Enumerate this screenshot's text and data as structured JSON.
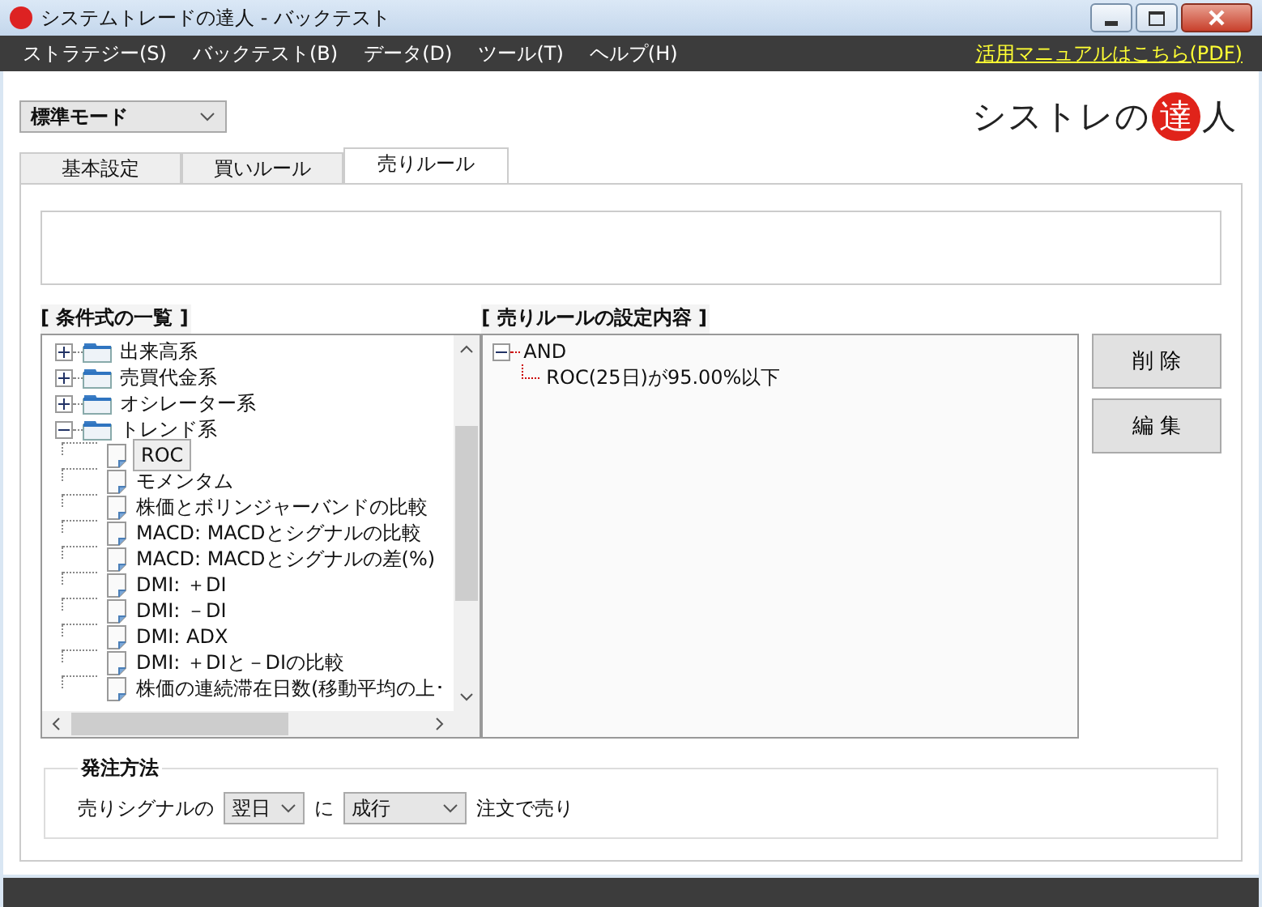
{
  "window": {
    "title": "システムトレードの達人 - バックテスト"
  },
  "menu": [
    "ストラテジー(S)",
    "バックテスト(B)",
    "データ(D)",
    "ツール(T)",
    "ヘルプ(H)"
  ],
  "manual_link": "活用マニュアルはこちら(PDF)",
  "mode_select": {
    "value": "標準モード"
  },
  "logo": {
    "before": "シストレの",
    "mark": "達",
    "after": "人"
  },
  "tabs": [
    {
      "label": "基本設定",
      "selected": false
    },
    {
      "label": "買いルール",
      "selected": false
    },
    {
      "label": "売りルール",
      "selected": true
    }
  ],
  "conditions": {
    "title": "[ 条件式の一覧 ]",
    "items": [
      {
        "label": "出来高系",
        "expanded": false
      },
      {
        "label": "売買代金系",
        "expanded": false
      },
      {
        "label": "オシレーター系",
        "expanded": false
      },
      {
        "label": "トレンド系",
        "expanded": true,
        "children": [
          {
            "label": "ROC",
            "selected": true
          },
          {
            "label": "モメンタム",
            "selected": false
          },
          {
            "label": "株価とボリンジャーバンドの比較",
            "selected": false
          },
          {
            "label": "MACD: MACDとシグナルの比較",
            "selected": false
          },
          {
            "label": "MACD: MACDとシグナルの差(%)",
            "selected": false
          },
          {
            "label": "DMI: ＋DI",
            "selected": false
          },
          {
            "label": "DMI: －DI",
            "selected": false
          },
          {
            "label": "DMI: ADX",
            "selected": false
          },
          {
            "label": "DMI: ＋DIと－DIの比較",
            "selected": false
          },
          {
            "label": "株価の連続滞在日数(移動平均の上･",
            "selected": false
          }
        ]
      }
    ]
  },
  "rules": {
    "title": "[ 売りルールの設定内容 ]",
    "items": [
      {
        "label": "AND",
        "expanded": true,
        "children": [
          {
            "label": "ROC(25日)が95.00%以下"
          }
        ]
      }
    ]
  },
  "buttons": [
    "削 除",
    "編 集"
  ],
  "order": {
    "title": "発注方法",
    "prefix": "売りシグナルの",
    "timing": "翌日",
    "middle": "に",
    "type": "成行",
    "suffix": "注文で売り"
  }
}
